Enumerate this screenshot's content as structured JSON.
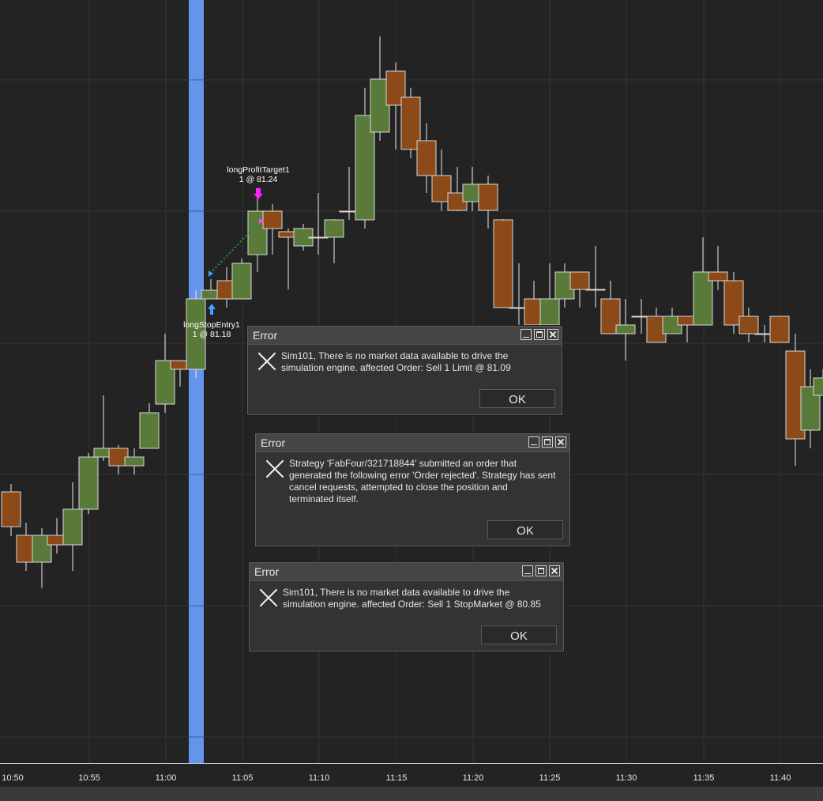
{
  "chart": {
    "background": "#232323",
    "up_color": "#5a7a3a",
    "down_color": "#8b4a18",
    "highlight_color": "#6495ed",
    "time_labels": [
      "10:50",
      "10:55",
      "11:00",
      "11:05",
      "11:10",
      "11:15",
      "11:20",
      "11:25",
      "11:30",
      "11:35",
      "11:40"
    ]
  },
  "orders": {
    "entry": {
      "name": "longStopEntry1",
      "detail": "1 @ 81.18"
    },
    "target": {
      "name": "longProfitTarget1",
      "detail": "1 @ 81.24"
    }
  },
  "dialogs": [
    {
      "title": "Error",
      "message": "Sim101, There is no market data available to drive the\nsimulation engine. affected Order: Sell 1 Limit @ 81.09",
      "ok": "OK"
    },
    {
      "title": "Error",
      "message": "Strategy 'FabFour/321718844' submitted an order that\ngenerated the following error 'Order rejected'. Strategy has sent\ncancel requests, attempted to close the position and\nterminated itself.",
      "ok": "OK"
    },
    {
      "title": "Error",
      "message": "Sim101, There is no market data available to drive the\nsimulation engine. affected Order: Sell 1 StopMarket @ 80.85",
      "ok": "OK"
    }
  ],
  "icons": {
    "entry_arrow": "arrow-up-icon",
    "target_arrow": "arrow-down-icon",
    "dialog_error": "x-error-icon",
    "minimize": "minimize-icon",
    "maximize": "maximize-icon",
    "close": "close-icon"
  }
}
